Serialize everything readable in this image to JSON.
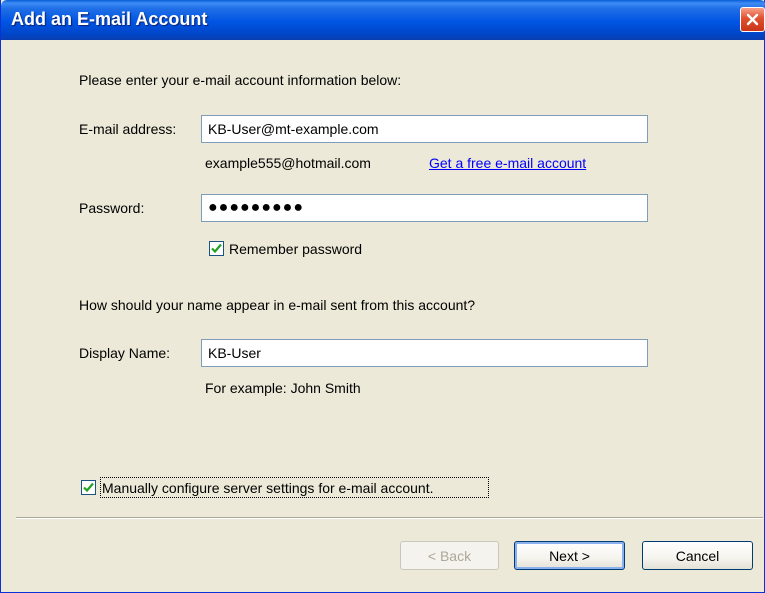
{
  "window": {
    "title": "Add an E-mail Account"
  },
  "form": {
    "intro_text": "Please enter your e-mail account information below:",
    "email_label": "E-mail address:",
    "email_value": "KB-User@mt-example.com",
    "email_example": "example555@hotmail.com",
    "free_account_link": "Get a free e-mail account",
    "password_label": "Password:",
    "password_value": "●●●●●●●●●",
    "remember_password_label": "Remember password",
    "remember_password_checked": true,
    "name_question": "How should your name appear in e-mail sent from this account?",
    "display_name_label": "Display Name:",
    "display_name_value": "KB-User",
    "display_name_example": "For example: John Smith",
    "manual_config_label": "Manually configure server settings for e-mail account.",
    "manual_config_checked": true
  },
  "buttons": {
    "back_label": "< Back",
    "next_label": "Next >",
    "cancel_label": "Cancel"
  },
  "icons": {
    "close": "close-icon",
    "checkmark": "checkmark-icon"
  },
  "colors": {
    "titlebar": "#0054e3",
    "dialog_bg": "#ece9d8",
    "link": "#0000ff",
    "close_button": "#e0502e",
    "checkmark": "#21a121"
  }
}
